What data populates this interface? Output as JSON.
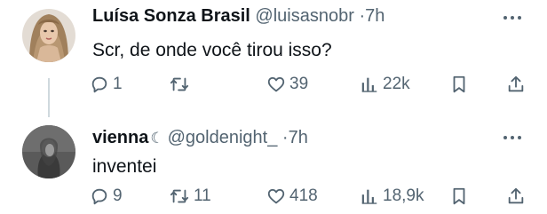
{
  "tweets": [
    {
      "display_name": "Luísa Sonza Brasil",
      "handle": "@luisasnobr",
      "separator": "·",
      "time": "7h",
      "text": "Scr, de onde você tirou isso?",
      "actions": {
        "replies": "1",
        "retweets": "",
        "likes": "39",
        "views": "22k"
      }
    },
    {
      "display_name": "vienna",
      "name_emoji": "☾",
      "handle": "@goldenight_",
      "separator": "·",
      "time": "7h",
      "text": "inventei",
      "actions": {
        "replies": "9",
        "retweets": "11",
        "likes": "418",
        "views": "18,9k"
      }
    }
  ],
  "icons": {
    "reply": "reply-icon",
    "retweet": "retweet-icon",
    "like": "heart-icon",
    "views": "views-chart-icon",
    "bookmark": "bookmark-icon",
    "share": "share-icon",
    "more": "more-dots-icon"
  },
  "colors": {
    "text_primary": "#0f1419",
    "text_secondary": "#536471",
    "thread_line": "#cfd9de"
  }
}
